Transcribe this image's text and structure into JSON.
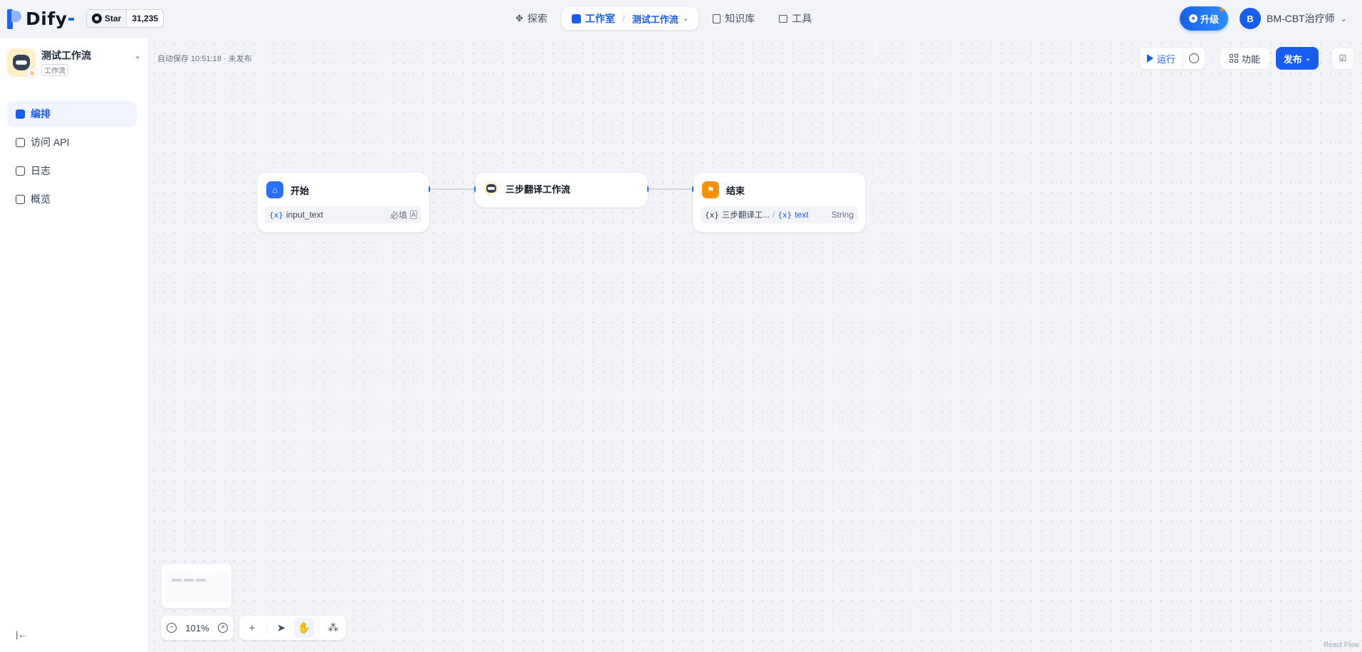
{
  "header": {
    "logo_text": "Dify",
    "github": {
      "star_label": "Star",
      "star_count": "31,235"
    },
    "nav": [
      {
        "label": "探索",
        "icon": "explore-icon"
      },
      {
        "label": "工作室",
        "icon": "studio-icon",
        "sub_label": "测试工作流"
      },
      {
        "label": "知识库",
        "icon": "knowledge-icon"
      },
      {
        "label": "工具",
        "icon": "tools-icon"
      }
    ],
    "upgrade_label": "升级",
    "user": {
      "initial": "B",
      "name": "BM-CBT治疗师"
    }
  },
  "sidebar": {
    "app_name": "测试工作流",
    "app_type": "工作流",
    "items": [
      {
        "label": "编排",
        "active": true
      },
      {
        "label": "访问 API",
        "active": false
      },
      {
        "label": "日志",
        "active": false
      },
      {
        "label": "概览",
        "active": false
      }
    ]
  },
  "canvas": {
    "autosave": "自动保存 10:51:18 · 未发布",
    "toolbar": {
      "run_label": "运行",
      "feature_label": "功能",
      "publish_label": "发布"
    },
    "nodes": {
      "start": {
        "title": "开始",
        "var_name": "input_text",
        "var_required": "必填",
        "var_type_icon": "A"
      },
      "workflow": {
        "title": "三步翻译工作流"
      },
      "end": {
        "title": "结束",
        "var_source": "三步翻译工...",
        "var_name": "text",
        "var_type": "String"
      }
    },
    "zoom": "101%",
    "attribution": "React Flow"
  },
  "colors": {
    "primary": "#155eef",
    "start_node": "#2970ff",
    "end_node": "#f79009"
  }
}
